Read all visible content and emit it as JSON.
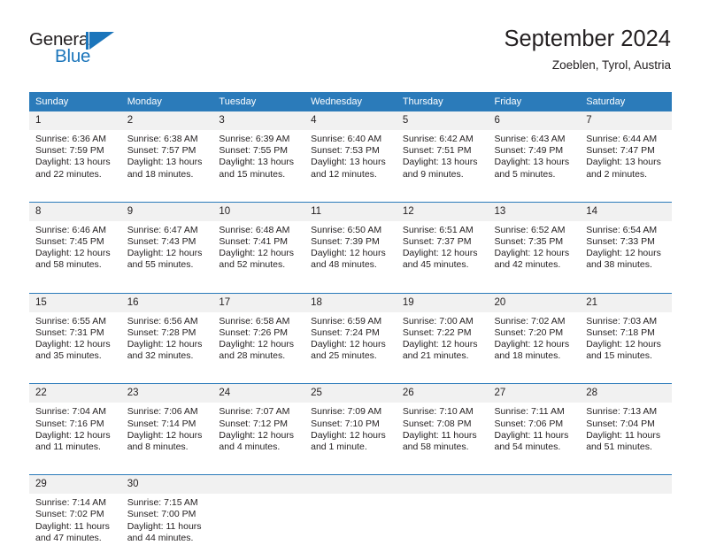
{
  "logo": {
    "text_general": "General",
    "text_blue": "Blue",
    "accent_color": "#1b75bb"
  },
  "header": {
    "title": "September 2024",
    "subtitle": "Zoeblen, Tyrol, Austria"
  },
  "theme": {
    "header_blue": "#2b7bba",
    "daynum_band": "#f1f1f1",
    "text": "#231f20"
  },
  "weekday_headers": [
    "Sunday",
    "Monday",
    "Tuesday",
    "Wednesday",
    "Thursday",
    "Friday",
    "Saturday"
  ],
  "weeks": [
    {
      "daynums": [
        "1",
        "2",
        "3",
        "4",
        "5",
        "6",
        "7"
      ],
      "cells": [
        {
          "sunrise": "Sunrise: 6:36 AM",
          "sunset": "Sunset: 7:59 PM",
          "daylight_1": "Daylight: 13 hours",
          "daylight_2": "and 22 minutes."
        },
        {
          "sunrise": "Sunrise: 6:38 AM",
          "sunset": "Sunset: 7:57 PM",
          "daylight_1": "Daylight: 13 hours",
          "daylight_2": "and 18 minutes."
        },
        {
          "sunrise": "Sunrise: 6:39 AM",
          "sunset": "Sunset: 7:55 PM",
          "daylight_1": "Daylight: 13 hours",
          "daylight_2": "and 15 minutes."
        },
        {
          "sunrise": "Sunrise: 6:40 AM",
          "sunset": "Sunset: 7:53 PM",
          "daylight_1": "Daylight: 13 hours",
          "daylight_2": "and 12 minutes."
        },
        {
          "sunrise": "Sunrise: 6:42 AM",
          "sunset": "Sunset: 7:51 PM",
          "daylight_1": "Daylight: 13 hours",
          "daylight_2": "and 9 minutes."
        },
        {
          "sunrise": "Sunrise: 6:43 AM",
          "sunset": "Sunset: 7:49 PM",
          "daylight_1": "Daylight: 13 hours",
          "daylight_2": "and 5 minutes."
        },
        {
          "sunrise": "Sunrise: 6:44 AM",
          "sunset": "Sunset: 7:47 PM",
          "daylight_1": "Daylight: 13 hours",
          "daylight_2": "and 2 minutes."
        }
      ]
    },
    {
      "daynums": [
        "8",
        "9",
        "10",
        "11",
        "12",
        "13",
        "14"
      ],
      "cells": [
        {
          "sunrise": "Sunrise: 6:46 AM",
          "sunset": "Sunset: 7:45 PM",
          "daylight_1": "Daylight: 12 hours",
          "daylight_2": "and 58 minutes."
        },
        {
          "sunrise": "Sunrise: 6:47 AM",
          "sunset": "Sunset: 7:43 PM",
          "daylight_1": "Daylight: 12 hours",
          "daylight_2": "and 55 minutes."
        },
        {
          "sunrise": "Sunrise: 6:48 AM",
          "sunset": "Sunset: 7:41 PM",
          "daylight_1": "Daylight: 12 hours",
          "daylight_2": "and 52 minutes."
        },
        {
          "sunrise": "Sunrise: 6:50 AM",
          "sunset": "Sunset: 7:39 PM",
          "daylight_1": "Daylight: 12 hours",
          "daylight_2": "and 48 minutes."
        },
        {
          "sunrise": "Sunrise: 6:51 AM",
          "sunset": "Sunset: 7:37 PM",
          "daylight_1": "Daylight: 12 hours",
          "daylight_2": "and 45 minutes."
        },
        {
          "sunrise": "Sunrise: 6:52 AM",
          "sunset": "Sunset: 7:35 PM",
          "daylight_1": "Daylight: 12 hours",
          "daylight_2": "and 42 minutes."
        },
        {
          "sunrise": "Sunrise: 6:54 AM",
          "sunset": "Sunset: 7:33 PM",
          "daylight_1": "Daylight: 12 hours",
          "daylight_2": "and 38 minutes."
        }
      ]
    },
    {
      "daynums": [
        "15",
        "16",
        "17",
        "18",
        "19",
        "20",
        "21"
      ],
      "cells": [
        {
          "sunrise": "Sunrise: 6:55 AM",
          "sunset": "Sunset: 7:31 PM",
          "daylight_1": "Daylight: 12 hours",
          "daylight_2": "and 35 minutes."
        },
        {
          "sunrise": "Sunrise: 6:56 AM",
          "sunset": "Sunset: 7:28 PM",
          "daylight_1": "Daylight: 12 hours",
          "daylight_2": "and 32 minutes."
        },
        {
          "sunrise": "Sunrise: 6:58 AM",
          "sunset": "Sunset: 7:26 PM",
          "daylight_1": "Daylight: 12 hours",
          "daylight_2": "and 28 minutes."
        },
        {
          "sunrise": "Sunrise: 6:59 AM",
          "sunset": "Sunset: 7:24 PM",
          "daylight_1": "Daylight: 12 hours",
          "daylight_2": "and 25 minutes."
        },
        {
          "sunrise": "Sunrise: 7:00 AM",
          "sunset": "Sunset: 7:22 PM",
          "daylight_1": "Daylight: 12 hours",
          "daylight_2": "and 21 minutes."
        },
        {
          "sunrise": "Sunrise: 7:02 AM",
          "sunset": "Sunset: 7:20 PM",
          "daylight_1": "Daylight: 12 hours",
          "daylight_2": "and 18 minutes."
        },
        {
          "sunrise": "Sunrise: 7:03 AM",
          "sunset": "Sunset: 7:18 PM",
          "daylight_1": "Daylight: 12 hours",
          "daylight_2": "and 15 minutes."
        }
      ]
    },
    {
      "daynums": [
        "22",
        "23",
        "24",
        "25",
        "26",
        "27",
        "28"
      ],
      "cells": [
        {
          "sunrise": "Sunrise: 7:04 AM",
          "sunset": "Sunset: 7:16 PM",
          "daylight_1": "Daylight: 12 hours",
          "daylight_2": "and 11 minutes."
        },
        {
          "sunrise": "Sunrise: 7:06 AM",
          "sunset": "Sunset: 7:14 PM",
          "daylight_1": "Daylight: 12 hours",
          "daylight_2": "and 8 minutes."
        },
        {
          "sunrise": "Sunrise: 7:07 AM",
          "sunset": "Sunset: 7:12 PM",
          "daylight_1": "Daylight: 12 hours",
          "daylight_2": "and 4 minutes."
        },
        {
          "sunrise": "Sunrise: 7:09 AM",
          "sunset": "Sunset: 7:10 PM",
          "daylight_1": "Daylight: 12 hours",
          "daylight_2": "and 1 minute."
        },
        {
          "sunrise": "Sunrise: 7:10 AM",
          "sunset": "Sunset: 7:08 PM",
          "daylight_1": "Daylight: 11 hours",
          "daylight_2": "and 58 minutes."
        },
        {
          "sunrise": "Sunrise: 7:11 AM",
          "sunset": "Sunset: 7:06 PM",
          "daylight_1": "Daylight: 11 hours",
          "daylight_2": "and 54 minutes."
        },
        {
          "sunrise": "Sunrise: 7:13 AM",
          "sunset": "Sunset: 7:04 PM",
          "daylight_1": "Daylight: 11 hours",
          "daylight_2": "and 51 minutes."
        }
      ]
    },
    {
      "daynums": [
        "29",
        "30",
        "",
        "",
        "",
        "",
        ""
      ],
      "cells": [
        {
          "sunrise": "Sunrise: 7:14 AM",
          "sunset": "Sunset: 7:02 PM",
          "daylight_1": "Daylight: 11 hours",
          "daylight_2": "and 47 minutes."
        },
        {
          "sunrise": "Sunrise: 7:15 AM",
          "sunset": "Sunset: 7:00 PM",
          "daylight_1": "Daylight: 11 hours",
          "daylight_2": "and 44 minutes."
        },
        {
          "sunrise": "",
          "sunset": "",
          "daylight_1": "",
          "daylight_2": ""
        },
        {
          "sunrise": "",
          "sunset": "",
          "daylight_1": "",
          "daylight_2": ""
        },
        {
          "sunrise": "",
          "sunset": "",
          "daylight_1": "",
          "daylight_2": ""
        },
        {
          "sunrise": "",
          "sunset": "",
          "daylight_1": "",
          "daylight_2": ""
        },
        {
          "sunrise": "",
          "sunset": "",
          "daylight_1": "",
          "daylight_2": ""
        }
      ]
    }
  ]
}
